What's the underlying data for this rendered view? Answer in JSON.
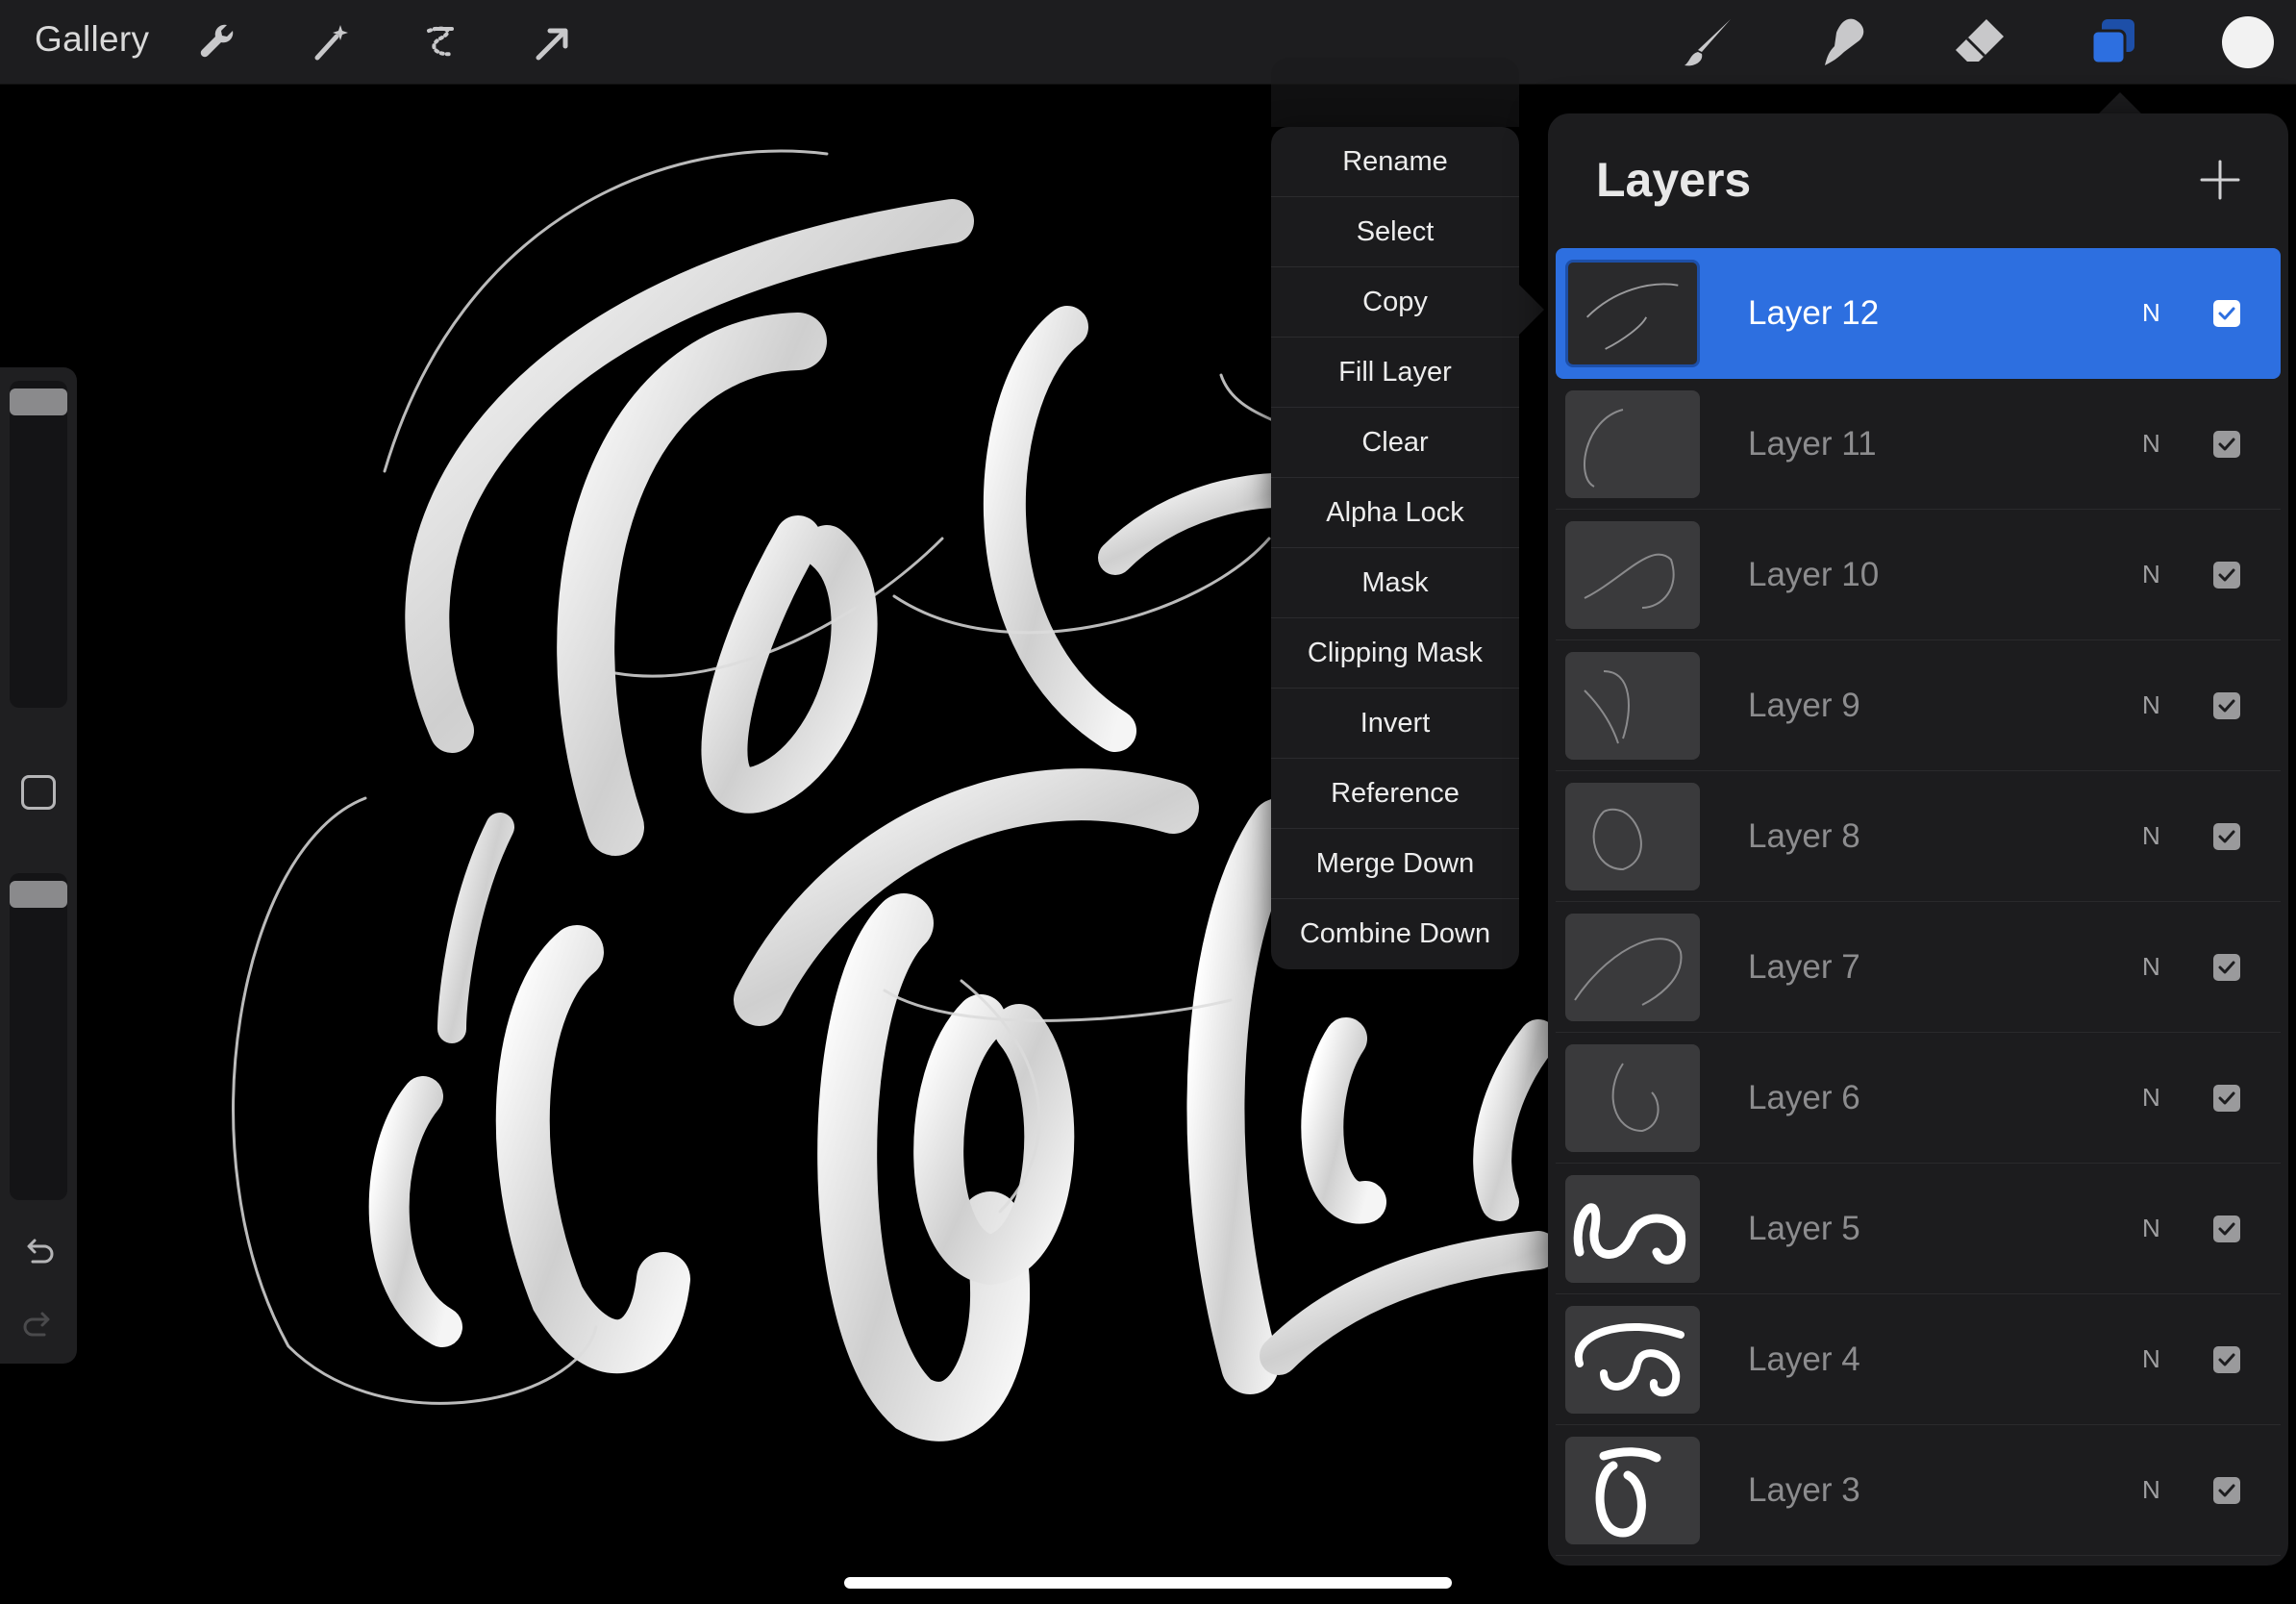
{
  "topbar": {
    "gallery_label": "Gallery",
    "left_tools": [
      "wrench-icon",
      "magic-wand-icon",
      "selection-icon",
      "transform-arrow-icon"
    ],
    "right_tools": [
      "brush-icon",
      "smudge-icon",
      "eraser-icon",
      "layers-icon",
      "color-swatch"
    ],
    "accent_color": "#2d6fe0",
    "current_color": "#f2f2f2"
  },
  "sidebar": {
    "brush_size_level": 0.02,
    "opacity_level": 0.02,
    "icons": [
      "modify-square-icon",
      "undo-icon",
      "redo-icon"
    ]
  },
  "context_menu": {
    "items": [
      "Rename",
      "Select",
      "Copy",
      "Fill Layer",
      "Clear",
      "Alpha Lock",
      "Mask",
      "Clipping Mask",
      "Invert",
      "Reference",
      "Merge Down",
      "Combine Down"
    ]
  },
  "layers_panel": {
    "title": "Layers",
    "add_icon": "plus-icon",
    "layers": [
      {
        "name": "Layer 12",
        "blend": "N",
        "visible": true,
        "active": true
      },
      {
        "name": "Layer 11",
        "blend": "N",
        "visible": true,
        "active": false
      },
      {
        "name": "Layer 10",
        "blend": "N",
        "visible": true,
        "active": false
      },
      {
        "name": "Layer 9",
        "blend": "N",
        "visible": true,
        "active": false
      },
      {
        "name": "Layer 8",
        "blend": "N",
        "visible": true,
        "active": false
      },
      {
        "name": "Layer 7",
        "blend": "N",
        "visible": true,
        "active": false
      },
      {
        "name": "Layer 6",
        "blend": "N",
        "visible": true,
        "active": false
      },
      {
        "name": "Layer 5",
        "blend": "N",
        "visible": true,
        "active": false
      },
      {
        "name": "Layer 4",
        "blend": "N",
        "visible": true,
        "active": false
      },
      {
        "name": "Layer 3",
        "blend": "N",
        "visible": true,
        "active": false
      }
    ]
  }
}
